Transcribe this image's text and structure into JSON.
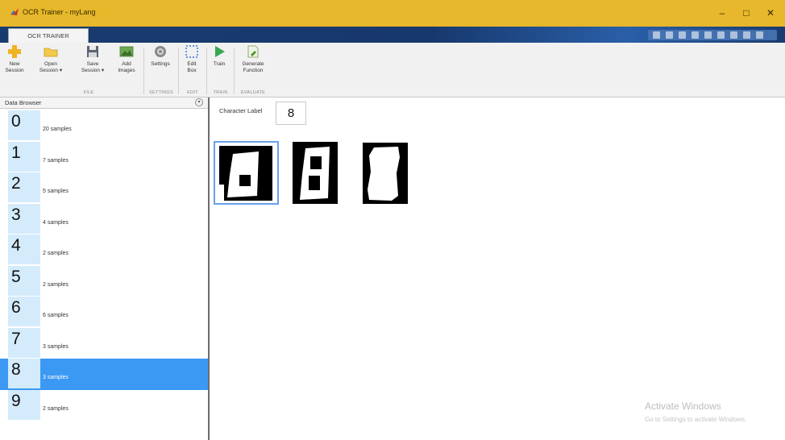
{
  "window": {
    "title": "OCR Trainer - myLang",
    "minimize_glyph": "–",
    "maximize_glyph": "□",
    "close_glyph": "✕"
  },
  "tab": {
    "label": "OCR TRAINER"
  },
  "ribbon": {
    "buttons": [
      {
        "label": "New\nSession",
        "icon": "plus-icon"
      },
      {
        "label": "Open\nSession ▾",
        "icon": "folder-icon"
      },
      {
        "label": "Save\nSession ▾",
        "icon": "floppy-disk-icon"
      },
      {
        "label": "Add\nImages",
        "icon": "image-icon"
      },
      {
        "label": "Settings",
        "icon": "gear-icon"
      },
      {
        "label": "Edit\nBox",
        "icon": "dashed-box-icon"
      },
      {
        "label": "Train",
        "icon": "play-icon"
      },
      {
        "label": "Generate\nFunction",
        "icon": "generate-function-icon"
      }
    ],
    "groups": [
      "FILE",
      "SETTINGS",
      "EDIT",
      "TRAIN",
      "EVALUATE"
    ]
  },
  "data_browser": {
    "title": "Data Browser",
    "items": [
      {
        "digit": "0",
        "samples": "20 samples"
      },
      {
        "digit": "1",
        "samples": "7 samples"
      },
      {
        "digit": "2",
        "samples": "5 samples"
      },
      {
        "digit": "3",
        "samples": "4 samples"
      },
      {
        "digit": "4",
        "samples": "2 samples"
      },
      {
        "digit": "5",
        "samples": "2 samples"
      },
      {
        "digit": "6",
        "samples": "6 samples"
      },
      {
        "digit": "7",
        "samples": "3 samples"
      },
      {
        "digit": "8",
        "samples": "3 samples"
      },
      {
        "digit": "9",
        "samples": "2 samples"
      }
    ],
    "selected_index": 8
  },
  "main": {
    "character_label_caption": "Character Label",
    "character_label_value": "8"
  },
  "watermark": {
    "line1": "Activate Windows",
    "line2": "Go to Settings to activate Windows."
  },
  "colors": {
    "titlebar": "#e7b82b",
    "tabbar": "#1a3b6e",
    "selection": "#3b99f3",
    "digit_tile": "#d4ebfb"
  }
}
